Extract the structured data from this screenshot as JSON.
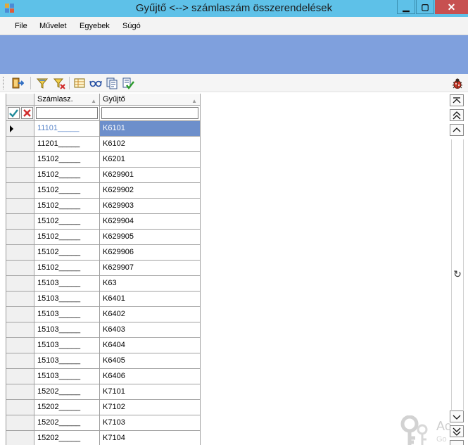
{
  "window": {
    "title": "Gyűjtő <--> számlaszám összerendelések",
    "minimize_glyph": "▁",
    "maximize_glyph": "▢",
    "close_glyph": "✕"
  },
  "menu": [
    "File",
    "Művelet",
    "Egyebek",
    "Súgó"
  ],
  "toolbar": {
    "icons": [
      "exit-icon",
      "filter-icon",
      "clear-filter-icon",
      "table-icon",
      "glasses-icon",
      "copy-icon",
      "approve-icon",
      "bug-icon"
    ]
  },
  "grid": {
    "columns": [
      "Számlasz.",
      "Gyűjtő"
    ],
    "filter_values": [
      "",
      ""
    ],
    "selected_index": 0,
    "rows": [
      {
        "szamla": "11101_____",
        "gyujto": "K6101"
      },
      {
        "szamla": "11201_____",
        "gyujto": "K6102"
      },
      {
        "szamla": "15102_____",
        "gyujto": "K6201"
      },
      {
        "szamla": "15102_____",
        "gyujto": "K629901"
      },
      {
        "szamla": "15102_____",
        "gyujto": "K629902"
      },
      {
        "szamla": "15102_____",
        "gyujto": "K629903"
      },
      {
        "szamla": "15102_____",
        "gyujto": "K629904"
      },
      {
        "szamla": "15102_____",
        "gyujto": "K629905"
      },
      {
        "szamla": "15102_____",
        "gyujto": "K629906"
      },
      {
        "szamla": "15102_____",
        "gyujto": "K629907"
      },
      {
        "szamla": "15103_____",
        "gyujto": "K63"
      },
      {
        "szamla": "15103_____",
        "gyujto": "K6401"
      },
      {
        "szamla": "15103_____",
        "gyujto": "K6402"
      },
      {
        "szamla": "15103_____",
        "gyujto": "K6403"
      },
      {
        "szamla": "15103_____",
        "gyujto": "K6404"
      },
      {
        "szamla": "15103_____",
        "gyujto": "K6405"
      },
      {
        "szamla": "15103_____",
        "gyujto": "K6406"
      },
      {
        "szamla": "15202_____",
        "gyujto": "K7101"
      },
      {
        "szamla": "15202_____",
        "gyujto": "K7102"
      },
      {
        "szamla": "15202_____",
        "gyujto": "K7103"
      },
      {
        "szamla": "15202_____",
        "gyujto": "K7104"
      }
    ]
  },
  "navigator": {
    "glyphs": {
      "first": "⏶",
      "page_up": "⏫",
      "up": "⌃",
      "refresh": "↻",
      "down": "⌄",
      "page_down": "⏬"
    }
  },
  "watermark": {
    "text": "Ac",
    "sub": "Go"
  },
  "colors": {
    "titlebar": "#5ec1e8",
    "banner": "#7fa0dd",
    "selected_cell": "#6d8fcb",
    "close_button": "#c75050"
  }
}
